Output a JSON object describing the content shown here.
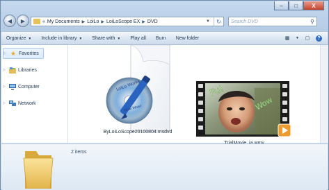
{
  "window": {
    "controls": {
      "minimize": "–",
      "maximize": "□",
      "close": "X"
    }
  },
  "address": {
    "breadcrumbs": [
      "«",
      "My Documents",
      "LoiLo",
      "LoiLoScope EX",
      "DVD"
    ],
    "search_placeholder": "Search DVD"
  },
  "toolbar": {
    "organize": "Organize",
    "include_in_library": "Include in library",
    "share_with": "Share with",
    "play_all": "Play all",
    "burn": "Burn",
    "new_folder": "New folder"
  },
  "sidebar": {
    "items": [
      {
        "label": "Favorites",
        "icon": "star-icon"
      },
      {
        "label": "Libraries",
        "icon": "library-icon"
      },
      {
        "label": "Computer",
        "icon": "computer-icon"
      },
      {
        "label": "Network",
        "icon": "network-icon"
      }
    ]
  },
  "files": [
    {
      "name": "ByLoiLoScope20100804.msdvd",
      "icon": "dvd-document-icon",
      "disc_text": "LoiLo Works",
      "disc_sub": "Wow Wow!"
    },
    {
      "name": "TrialMovie_ja.wmv",
      "icon": "video-thumbnail-icon",
      "overlay_text": [
        "Fu!",
        "Wow"
      ]
    }
  ],
  "details": {
    "item_count": "2 items"
  },
  "colors": {
    "accent": "#2d6bc4",
    "folder": "#e8c35a"
  }
}
